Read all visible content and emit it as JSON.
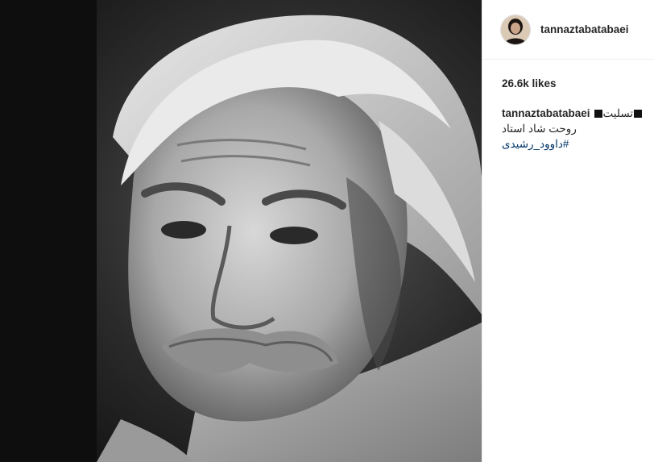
{
  "post": {
    "username": "tannaztabatabaei",
    "likes": "26.6k likes",
    "caption": {
      "user": "tannaztabatabaei",
      "word": "تسلیت",
      "line2": "روحت شاد استاد",
      "hashtag": "#داوود_رشیدی"
    }
  },
  "icons": {
    "avatar": "profile-photo",
    "square": "black-square-emoji"
  },
  "colors": {
    "link": "#003569",
    "text": "#262626",
    "border": "#efefef"
  }
}
